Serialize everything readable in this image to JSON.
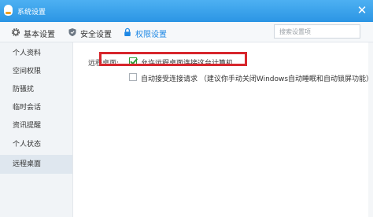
{
  "window": {
    "title": "系统设置"
  },
  "tabs": [
    {
      "label": "基本设置",
      "icon": "gear-icon"
    },
    {
      "label": "安全设置",
      "icon": "shield-icon"
    },
    {
      "label": "权限设置",
      "icon": "lock-icon"
    }
  ],
  "search": {
    "placeholder": "搜索设置项"
  },
  "sidebar": {
    "items": [
      {
        "label": "个人资料"
      },
      {
        "label": "空间权限"
      },
      {
        "label": "防骚扰"
      },
      {
        "label": "临时会话"
      },
      {
        "label": "资讯提醒"
      },
      {
        "label": "个人状态"
      },
      {
        "label": "远程桌面"
      }
    ],
    "active": "远程桌面"
  },
  "remote_desktop": {
    "section_label": "远程桌面:",
    "options": [
      {
        "label": "允许远程桌面连接这台计算机",
        "checked": true
      },
      {
        "label": "自动接受连接请求 （建议你手动关闭Windows自动睡眠和自动锁屏功能）",
        "checked": false
      }
    ]
  },
  "colors": {
    "titlebar": "#2b95e4",
    "accent": "#1e88e5",
    "highlight": "#d7262c",
    "check": "#2e9e3a"
  }
}
